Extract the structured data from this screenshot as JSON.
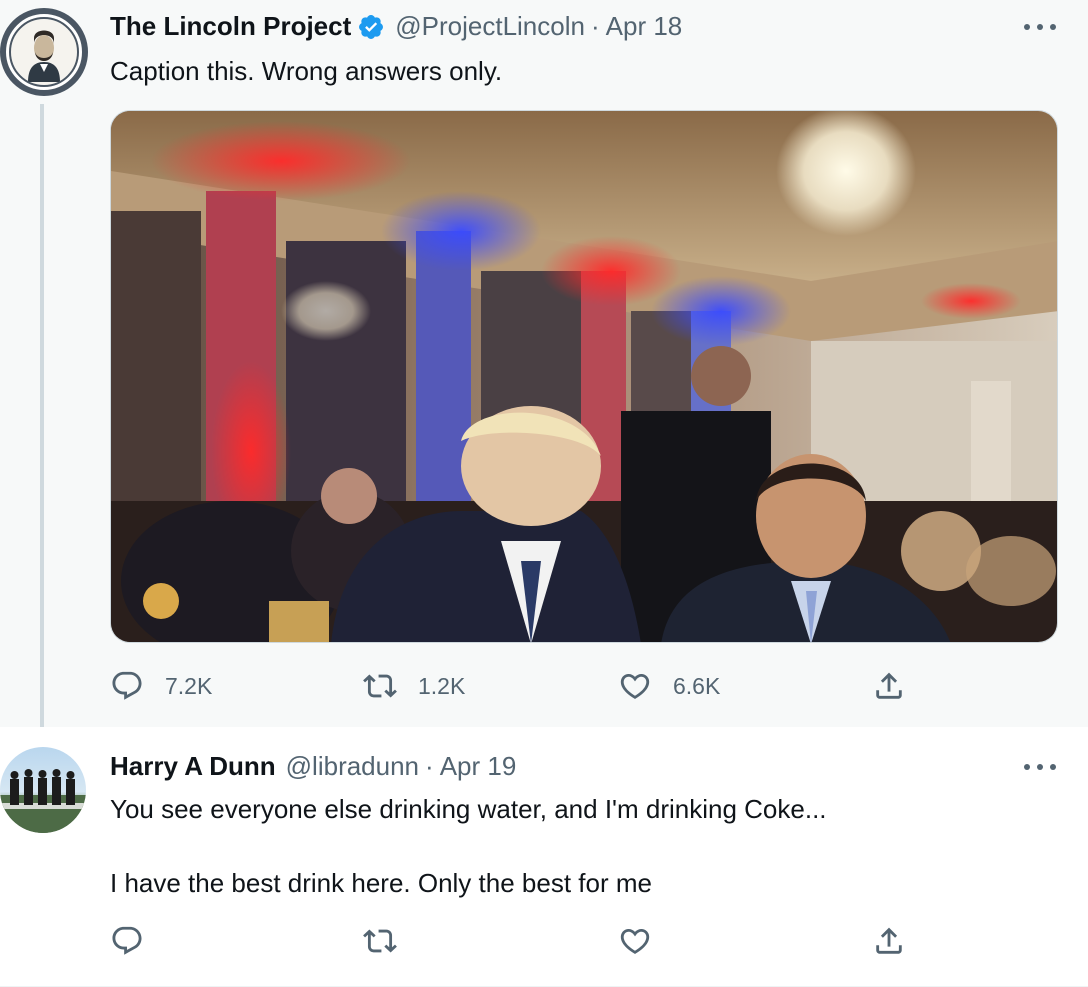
{
  "tweets": [
    {
      "author": {
        "name": "The Lincoln Project",
        "handle": "@ProjectLincoln",
        "verified": true
      },
      "separator": "·",
      "date": "Apr 18",
      "text": "Caption this. Wrong answers only.",
      "media": {
        "type": "photo"
      },
      "stats": {
        "replies": "7.2K",
        "retweets": "1.2K",
        "likes": "6.6K"
      },
      "icons": [
        "reply-icon",
        "retweet-icon",
        "like-icon",
        "share-icon",
        "more-icon",
        "verified-badge-icon"
      ]
    },
    {
      "author": {
        "name": "Harry A Dunn",
        "handle": "@libradunn"
      },
      "separator": "·",
      "date": "Apr 19",
      "text": "You see everyone else drinking water, and I'm drinking Coke...\n\nI have the best drink here. Only the best for me",
      "stats": {
        "replies": "",
        "retweets": "",
        "likes": ""
      },
      "icons": [
        "reply-icon",
        "retweet-icon",
        "like-icon",
        "share-icon",
        "more-icon"
      ]
    }
  ],
  "colors": {
    "text_primary": "#0f1419",
    "text_secondary": "#536471",
    "verified_blue": "#1d9bf0",
    "thread_line": "#cfd9de",
    "highlight_bg": "#f7f9f9"
  }
}
